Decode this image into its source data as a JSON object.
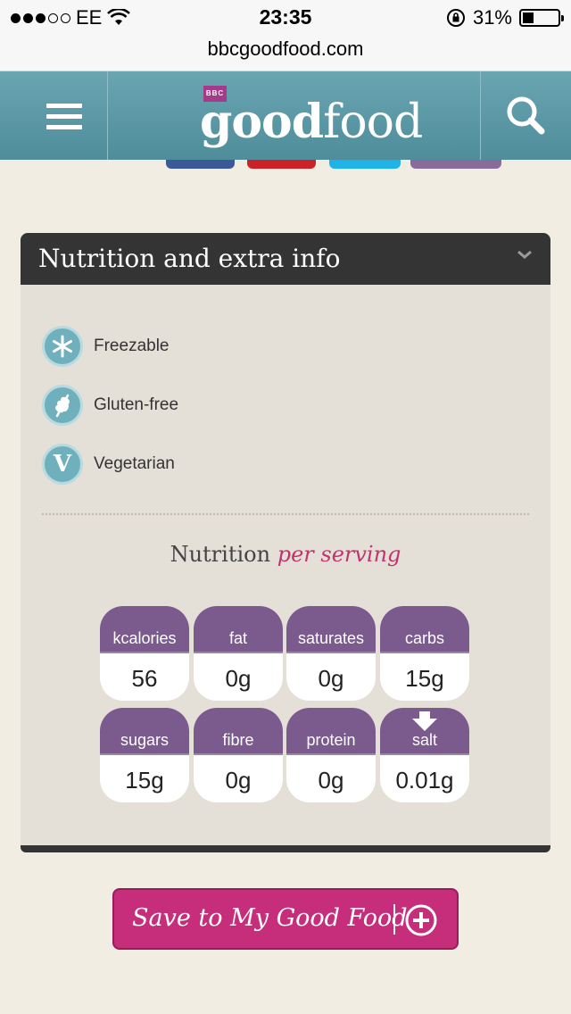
{
  "status_bar": {
    "carrier": "EE",
    "time": "23:35",
    "battery_percent": "31%",
    "battery_level": 0.31,
    "signal_bars_filled": 3,
    "signal_bars_total": 5
  },
  "url_bar": {
    "url": "bbcgoodfood.com"
  },
  "header": {
    "logo_badge": "BBC",
    "logo_bold": "good",
    "logo_light": "food",
    "menu_icon": "hamburger-menu-icon",
    "search_icon": "search-icon",
    "color": "#5c97a4"
  },
  "social_colors": [
    "#3b5998",
    "#cc2127",
    "#1fb4e8",
    "#8a6c9a"
  ],
  "nutrition_panel": {
    "heading": "Nutrition and extra info",
    "chevron_icon": "chevron-down-icon",
    "attributes": [
      {
        "label": "Freezable",
        "icon": "snowflake-icon"
      },
      {
        "label": "Gluten-free",
        "icon": "wheat-icon"
      },
      {
        "label": "Vegetarian",
        "icon": "vegetarian-v-icon"
      }
    ],
    "nutrition_title": "Nutrition",
    "nutrition_subtitle": "per serving",
    "tiles": [
      {
        "name": "kcalories",
        "value": "56"
      },
      {
        "name": "fat",
        "value": "0g"
      },
      {
        "name": "saturates",
        "value": "0g"
      },
      {
        "name": "carbs",
        "value": "15g"
      },
      {
        "name": "sugars",
        "value": "15g"
      },
      {
        "name": "fibre",
        "value": "0g"
      },
      {
        "name": "protein",
        "value": "0g"
      },
      {
        "name": "salt",
        "value": "0.01g",
        "indicator": "low-arrow-down-icon"
      }
    ],
    "accent_color": "#c2336e",
    "tile_color": "#7b5a8d"
  },
  "save_button": {
    "label": "Save to My Good Food",
    "icon": "plus-circle-icon",
    "color": "#c62d7a"
  }
}
